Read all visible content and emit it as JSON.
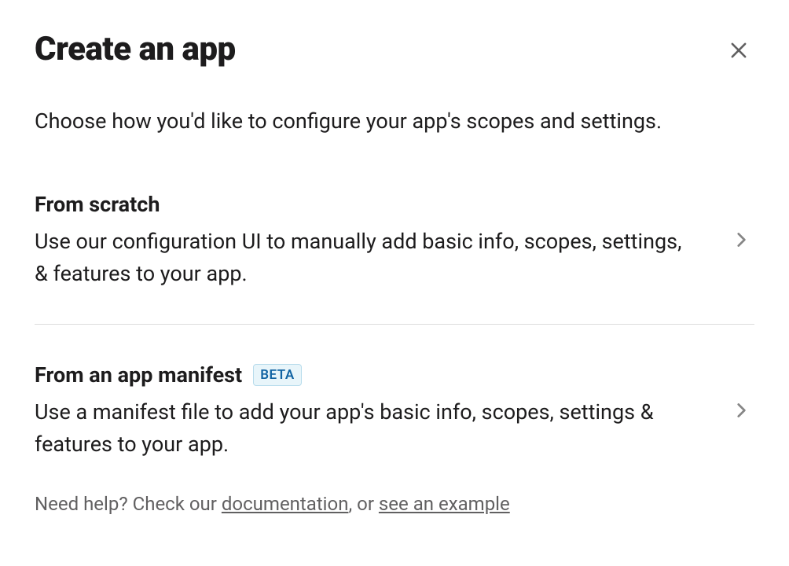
{
  "modal": {
    "title": "Create an app",
    "subtitle": "Choose how you'd like to configure your app's scopes and settings."
  },
  "options": {
    "scratch": {
      "title": "From scratch",
      "description": "Use our configuration UI to manually add basic info, scopes, settings, & features to your app."
    },
    "manifest": {
      "title": "From an app manifest",
      "badge": "BETA",
      "description": "Use a manifest file to add your app's basic info, scopes, settings & features to your app."
    }
  },
  "help": {
    "prefix": "Need help? Check our ",
    "doc_link": "documentation",
    "middle": ", or ",
    "example_link": "see an example"
  }
}
